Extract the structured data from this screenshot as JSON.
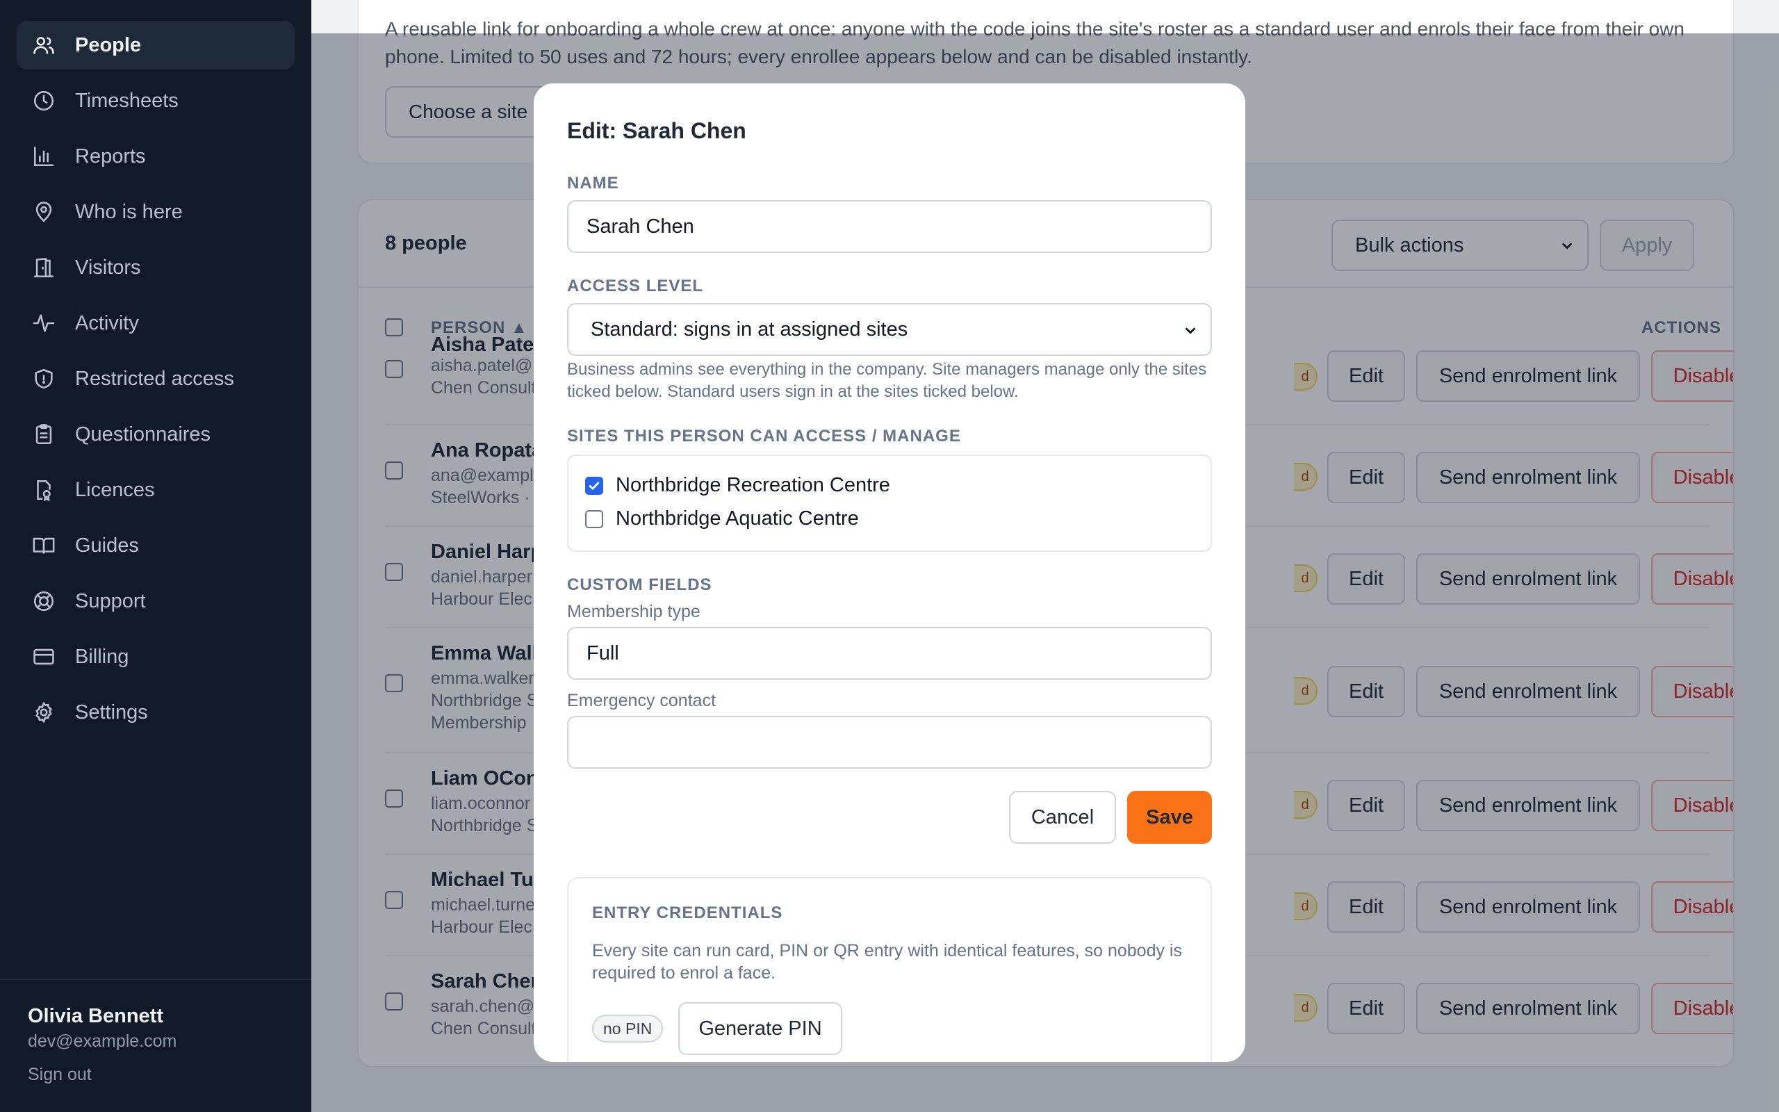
{
  "sidebar": {
    "items": [
      {
        "label": "People",
        "icon": "users-icon",
        "active": true
      },
      {
        "label": "Timesheets",
        "icon": "clock-icon"
      },
      {
        "label": "Reports",
        "icon": "bar-chart-icon"
      },
      {
        "label": "Who is here",
        "icon": "map-pin-icon"
      },
      {
        "label": "Visitors",
        "icon": "door-icon"
      },
      {
        "label": "Activity",
        "icon": "activity-icon"
      },
      {
        "label": "Restricted access",
        "icon": "shield-icon"
      },
      {
        "label": "Questionnaires",
        "icon": "clipboard-icon"
      },
      {
        "label": "Licences",
        "icon": "license-icon"
      },
      {
        "label": "Guides",
        "icon": "book-icon"
      },
      {
        "label": "Support",
        "icon": "lifebuoy-icon"
      },
      {
        "label": "Billing",
        "icon": "credit-card-icon"
      },
      {
        "label": "Settings",
        "icon": "gear-icon"
      }
    ],
    "user": {
      "name": "Olivia Bennett",
      "email": "dev@example.com",
      "sign_out": "Sign out"
    }
  },
  "crew_link": {
    "description": "A reusable link for onboarding a whole crew at once: anyone with the code joins the site's roster as a standard user and enrols their face from their own phone. Limited to 50 uses and 72 hours; every enrollee appears below and can be disabled instantly.",
    "choose_site_label": "Choose a site"
  },
  "people_list": {
    "count_label": "8 people",
    "bulk_actions_label": "Bulk actions",
    "apply_label": "Apply",
    "columns": {
      "person": "PERSON ▲",
      "actions": "ACTIONS"
    },
    "row_actions": {
      "edit": "Edit",
      "send": "Send enrolment link",
      "disable": "Disable"
    },
    "rows": [
      {
        "name": "Aisha Patel",
        "email": "aisha.patel@",
        "org": "Chen Consult",
        "extra": ""
      },
      {
        "name": "Ana Ropata",
        "email": "ana@exampl",
        "org": "SteelWorks ·",
        "extra": ""
      },
      {
        "name": "Daniel Harp",
        "email": "daniel.harper",
        "org": "Harbour Elec",
        "extra": ""
      },
      {
        "name": "Emma Walk",
        "email": "emma.walker",
        "org": "Northbridge S",
        "extra": "Membership"
      },
      {
        "name": "Liam OCon",
        "email": "liam.oconnor",
        "org": "Northbridge S",
        "extra": ""
      },
      {
        "name": "Michael Tu",
        "email": "michael.turne",
        "org": "Harbour Elec",
        "extra": ""
      },
      {
        "name": "Sarah Chen",
        "email": "sarah.chen@",
        "org": "Chen Consult",
        "extra": ""
      }
    ]
  },
  "modal": {
    "title": "Edit: Sarah Chen",
    "name_label": "NAME",
    "name_value": "Sarah Chen",
    "access_label": "ACCESS LEVEL",
    "access_value": "Standard: signs in at assigned sites",
    "access_help": "Business admins see everything in the company. Site managers manage only the sites ticked below. Standard users sign in at the sites ticked below.",
    "sites_label": "SITES THIS PERSON CAN ACCESS / MANAGE",
    "sites": [
      {
        "name": "Northbridge Recreation Centre",
        "checked": true
      },
      {
        "name": "Northbridge Aquatic Centre",
        "checked": false
      }
    ],
    "custom_fields_label": "CUSTOM FIELDS",
    "membership_label": "Membership type",
    "membership_value": "Full",
    "emergency_label": "Emergency contact",
    "emergency_value": "",
    "cancel_label": "Cancel",
    "save_label": "Save",
    "credentials": {
      "title": "ENTRY CREDENTIALS",
      "description": "Every site can run card, PIN or QR entry with identical features, so nobody is required to enrol a face.",
      "pin_status": "no PIN",
      "generate_label": "Generate PIN"
    }
  },
  "colors": {
    "sidebar_bg": "#111a28",
    "accent": "#f97316",
    "danger": "#dc2626",
    "checkbox_checked": "#2563eb"
  }
}
